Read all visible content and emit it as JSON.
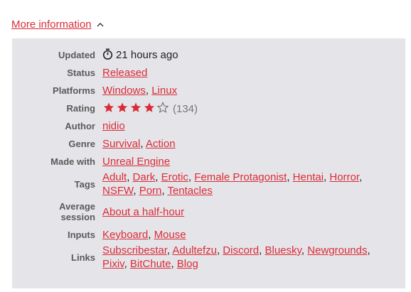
{
  "toggle": {
    "label": "More information",
    "icon": "chevron-up-icon"
  },
  "colors": {
    "link": "#da2c38",
    "panel_bg": "#e5e5e9",
    "star": "#da2c38"
  },
  "info": {
    "updated": {
      "label": "Updated",
      "value": "21 hours ago",
      "icon": "stopwatch-icon"
    },
    "status": {
      "label": "Status",
      "value": "Released"
    },
    "platforms": {
      "label": "Platforms",
      "items": [
        "Windows",
        "Linux"
      ]
    },
    "rating": {
      "label": "Rating",
      "stars_filled": 4,
      "stars_total": 5,
      "count": "(134)"
    },
    "author": {
      "label": "Author",
      "value": "nidio"
    },
    "genre": {
      "label": "Genre",
      "items": [
        "Survival",
        "Action"
      ]
    },
    "made_with": {
      "label": "Made with",
      "value": "Unreal Engine"
    },
    "tags": {
      "label": "Tags",
      "items": [
        "Adult",
        "Dark",
        "Erotic",
        "Female Protagonist",
        "Hentai",
        "Horror",
        "NSFW",
        "Porn",
        "Tentacles"
      ]
    },
    "average_session": {
      "label_line1": "Average",
      "label_line2": "session",
      "value": "About a half-hour"
    },
    "inputs": {
      "label": "Inputs",
      "items": [
        "Keyboard",
        "Mouse"
      ]
    },
    "links": {
      "label": "Links",
      "items": [
        "Subscribestar",
        "Adultefzu",
        "Discord",
        "Bluesky",
        "Newgrounds",
        "Pixiv",
        "BitChute",
        "Blog"
      ]
    }
  }
}
